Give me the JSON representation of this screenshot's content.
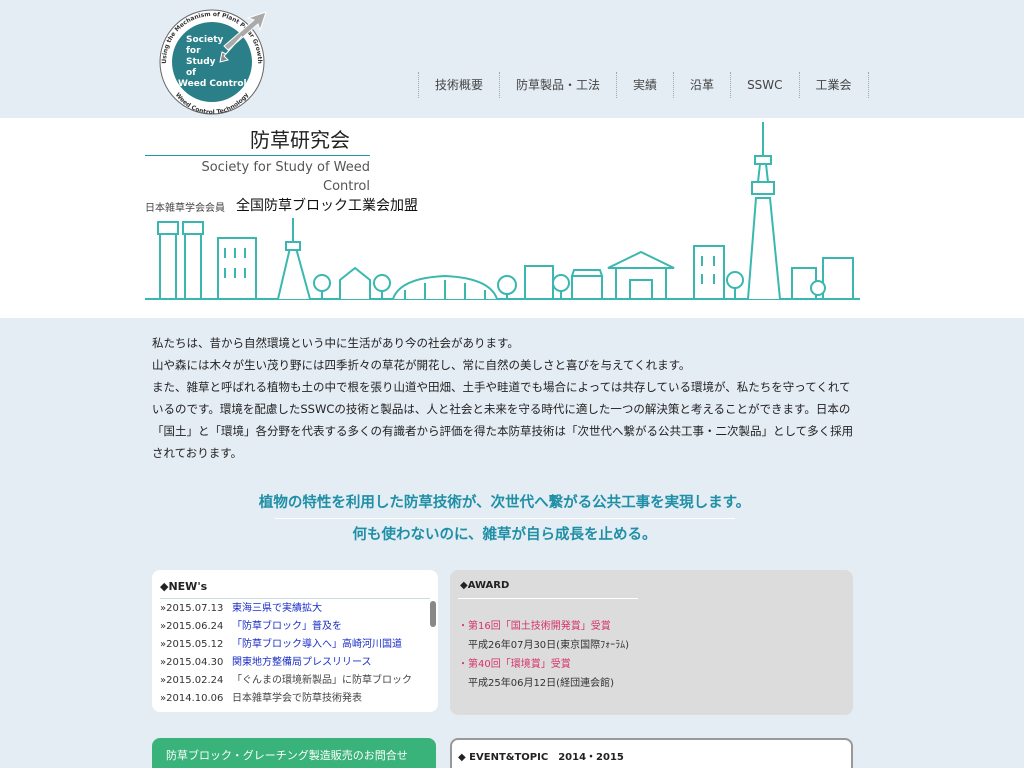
{
  "logo": {
    "lines": [
      "Society",
      "for",
      "Study",
      "of",
      "Weed Control"
    ],
    "ring_text_top": "Using the Mechanism of Plant Polar Growth",
    "ring_text_bottom": "Weed Control Technology"
  },
  "nav": {
    "items": [
      {
        "label": "技術概要"
      },
      {
        "label": "防草製品・工法"
      },
      {
        "label": "実績"
      },
      {
        "label": "沿革"
      },
      {
        "label": "SSWC"
      },
      {
        "label": "工業会"
      }
    ]
  },
  "banner": {
    "title_jp": "防草研究会",
    "title_en": "Society for Study of Weed Control",
    "member_small": "日本雑草学会会員",
    "member_big": "全国防草ブロック工業会加盟"
  },
  "intro": {
    "paragraph": "私たちは、昔から自然環境という中に生活があり今の社会があります。\n山や森には木々が生い茂り野には四季折々の草花が開花し、常に自然の美しさと喜びを与えてくれます。\nまた、雑草と呼ばれる植物も土の中で根を張り山道や田畑、土手や畦道でも場合によっては共存している環境が、私たちを守ってくれているのです。環境を配慮したSSWCの技術と製品は、人と社会と未来を守る時代に適した一つの解決策と考えることができます。日本の「国土」と「環境」各分野を代表する多くの有識者から評価を得た本防草技術は「次世代へ繋がる公共工事・二次製品」として多く採用されております。"
  },
  "tagline": {
    "line1": "植物の特性を利用した防草技術が、次世代へ繋がる公共工事を実現します。",
    "line2": "何も使わないのに、雑草が自ら成長を止める。"
  },
  "news": {
    "title": "◆NEW's",
    "items": [
      {
        "date": "»2015.07.13",
        "text": "東海三県で実績拡大",
        "link": true
      },
      {
        "date": "»2015.06.24",
        "text": "「防草ブロック」普及を",
        "link": true
      },
      {
        "date": "»2015.05.12",
        "text": "「防草ブロック導入へ」高崎河川国道",
        "link": true
      },
      {
        "date": "»2015.04.30",
        "text": "関東地方整備局プレスリリース",
        "link": true
      },
      {
        "date": "»2015.02.24",
        "text": "「ぐんまの環境新製品」に防草ブロック",
        "link": false
      },
      {
        "date": "»2014.10.06",
        "text": "日本雑草学会で防草技術発表",
        "link": false
      }
    ]
  },
  "award": {
    "title": "◆AWARD",
    "items": [
      {
        "name": "・第16回「国土技術開発賞」受賞",
        "date": "平成26年07月30日(東京国際ﾌｫｰﾗﾑ)"
      },
      {
        "name": "・第40回「環境賞」受賞",
        "date": "平成25年06月12日(経団連会館)"
      }
    ]
  },
  "contact": {
    "label": "防草ブロック・グレーチング製造販売のお問合せ"
  },
  "event": {
    "title": "◆ EVENT&TOPIC　2014・2015"
  },
  "colors": {
    "accent_teal": "#1f8fa6",
    "logo_teal": "#2a7f89",
    "news_link": "#1a2ec8",
    "award_pink": "#d6336c",
    "contact_green": "#3ab37a"
  }
}
